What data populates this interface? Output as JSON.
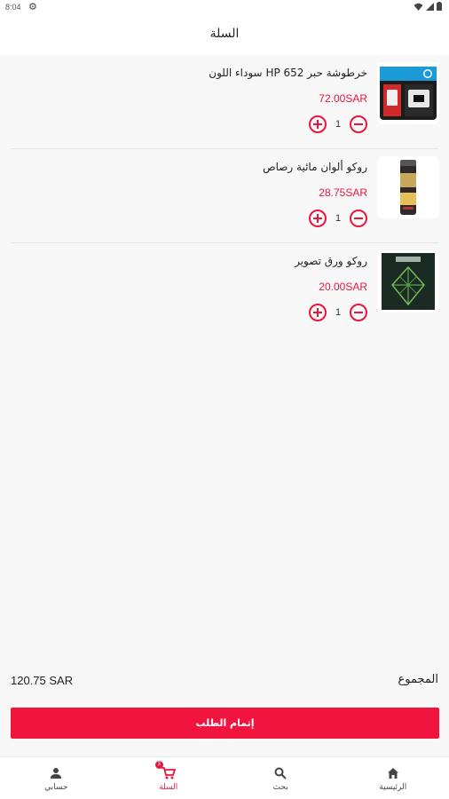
{
  "status_bar": {
    "time": "8:04"
  },
  "header": {
    "title": "السلة"
  },
  "cart": {
    "items": [
      {
        "name": "خرطوشة حبر HP 652 سوداء اللون",
        "price": "72.00SAR",
        "quantity": "1",
        "thumb_icon": "hp-ink-cartridge-image"
      },
      {
        "name": "روكو  ألوان مائية رصاص",
        "price": "28.75SAR",
        "quantity": "1",
        "thumb_icon": "watercolor-pencils-tube-image"
      },
      {
        "name": "روكو  ورق تصوير",
        "price": "20.00SAR",
        "quantity": "1",
        "thumb_icon": "photo-paper-box-image"
      }
    ]
  },
  "summary": {
    "total_label": "المجموع",
    "total_value": "120.75 SAR"
  },
  "checkout": {
    "label": "إتمام الطلب"
  },
  "bottom_nav": {
    "home": "الرئيسية",
    "search": "بحث",
    "cart": "السلة",
    "cart_badge": "3",
    "account": "حسابي"
  },
  "colors": {
    "accent": "#e8163f",
    "background": "#f7f7f7"
  }
}
